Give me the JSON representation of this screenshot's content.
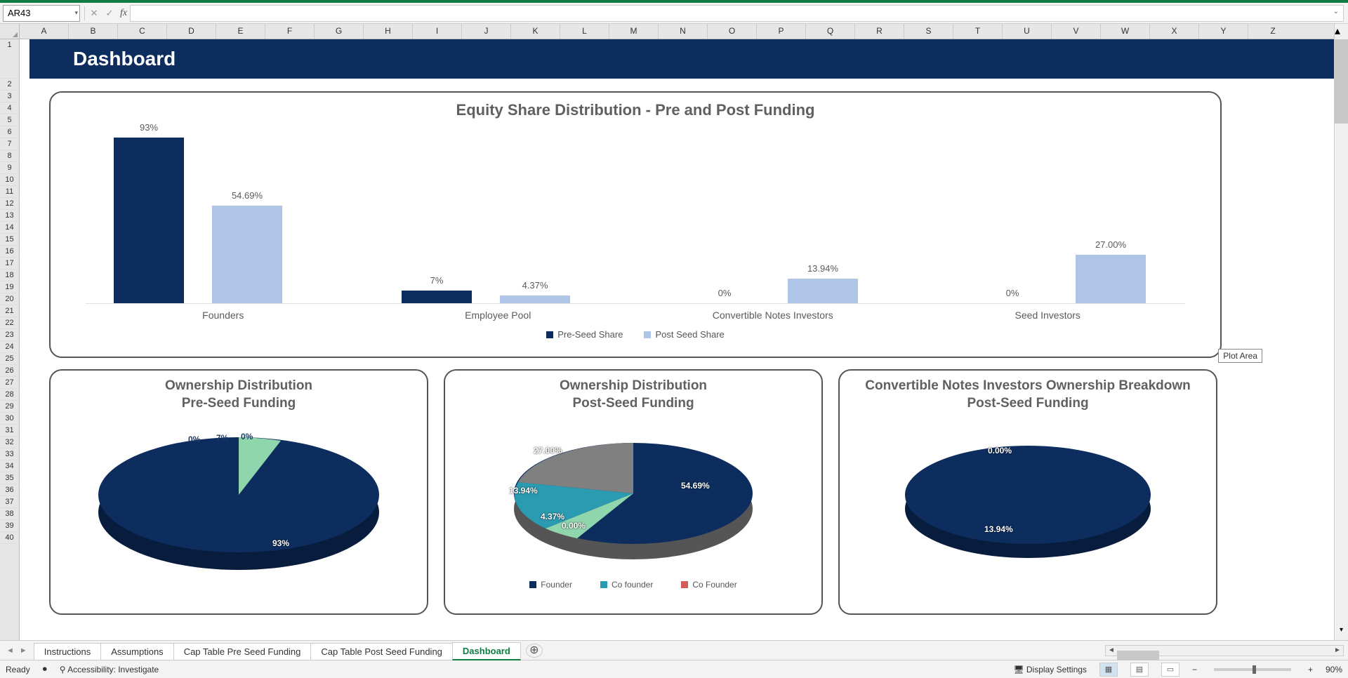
{
  "formula_bar": {
    "cell_ref": "AR43",
    "cancel": "✕",
    "confirm": "✓",
    "fx": "fx",
    "down_icon": "▾"
  },
  "columns": [
    "A",
    "B",
    "C",
    "D",
    "E",
    "F",
    "G",
    "H",
    "I",
    "J",
    "K",
    "L",
    "M",
    "N",
    "O",
    "P",
    "Q",
    "R",
    "S",
    "T",
    "U",
    "V",
    "W",
    "X",
    "Y",
    "Z"
  ],
  "rows": [
    1,
    2,
    3,
    4,
    5,
    6,
    7,
    8,
    9,
    10,
    11,
    12,
    13,
    14,
    15,
    16,
    17,
    18,
    19,
    20,
    21,
    22,
    23,
    24,
    25,
    26,
    27,
    28,
    29,
    30,
    31,
    32,
    33,
    34,
    35,
    36,
    37,
    38,
    39,
    40
  ],
  "banner_title": "Dashboard",
  "plot_area_tooltip": "Plot Area",
  "chart_data": [
    {
      "type": "bar",
      "title": "Equity Share Distribution - Pre and Post Funding",
      "categories": [
        "Founders",
        "Employee Pool",
        "Convertible Notes Investors",
        "Seed Investors"
      ],
      "series": [
        {
          "name": "Pre-Seed Share",
          "color": "#0d2d5e",
          "values": [
            93,
            7,
            0,
            0
          ],
          "labels": [
            "93%",
            "7%",
            "0%",
            "0%"
          ]
        },
        {
          "name": "Post Seed Share",
          "color": "#aec5e8",
          "values": [
            54.69,
            4.37,
            13.94,
            27.0
          ],
          "labels": [
            "54.69%",
            "4.37%",
            "13.94%",
            "27.00%"
          ]
        }
      ]
    },
    {
      "type": "pie",
      "title": "Ownership Distribution",
      "subtitle": "Pre-Seed Funding",
      "labels": [
        "93%",
        "0%",
        "7%",
        "0%"
      ],
      "slices": [
        {
          "v": 93,
          "c": "#0d2d5e"
        },
        {
          "v": 0,
          "c": "#d45b5b"
        },
        {
          "v": 7,
          "c": "#90d6ad"
        },
        {
          "v": 0,
          "c": "#2a9bb0"
        }
      ]
    },
    {
      "type": "pie",
      "title": "Ownership Distribution",
      "subtitle": "Post-Seed Funding",
      "labels": [
        "54.69%",
        "0.00%",
        "4.37%",
        "13.94%",
        "27.00%"
      ],
      "legend": [
        "Founder",
        "Co founder",
        "Co Founder"
      ],
      "slices": [
        {
          "v": 54.69,
          "c": "#0d2d5e"
        },
        {
          "v": 0,
          "c": "#d45b5b"
        },
        {
          "v": 4.37,
          "c": "#90d6ad"
        },
        {
          "v": 13.94,
          "c": "#2a9bb0"
        },
        {
          "v": 27,
          "c": "#808080"
        }
      ]
    },
    {
      "type": "pie",
      "title": "Convertible Notes Investors Ownership Breakdown",
      "subtitle": "Post-Seed Funding",
      "labels": [
        "0.00%",
        "13.94%"
      ],
      "slices": [
        {
          "v": 0,
          "c": "#2a9bb0"
        },
        {
          "v": 100,
          "c": "#0d2d5e"
        }
      ]
    }
  ],
  "sheet_tabs": [
    {
      "label": "Instructions",
      "active": false
    },
    {
      "label": "Assumptions",
      "active": false
    },
    {
      "label": "Cap Table Pre Seed Funding",
      "active": false
    },
    {
      "label": "Cap Table Post Seed Funding",
      "active": false
    },
    {
      "label": "Dashboard",
      "active": true
    }
  ],
  "tab_nav": {
    "prev": "◄",
    "next": "►"
  },
  "add_sheet": "⊕",
  "status": {
    "ready": "Ready",
    "accessibility": "Accessibility: Investigate",
    "display_settings": "Display Settings",
    "zoom": "90%",
    "minus": "−",
    "plus": "+"
  }
}
